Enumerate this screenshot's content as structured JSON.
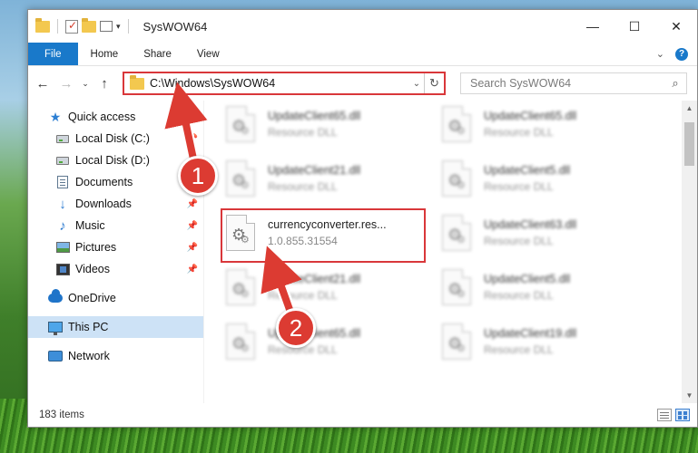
{
  "window": {
    "title": "SysWOW64",
    "controls": {
      "minimize": "—",
      "maximize": "☐",
      "close": "✕"
    }
  },
  "ribbon": {
    "tabs": [
      "File",
      "Home",
      "Share",
      "View"
    ]
  },
  "navbar": {
    "address": "C:\\Windows\\SysWOW64",
    "search_placeholder": "Search SysWOW64"
  },
  "sidebar": {
    "items": [
      {
        "label": "Quick access",
        "icon": "star-icon"
      },
      {
        "label": "Local Disk (C:)",
        "icon": "drive-icon",
        "pinned": true
      },
      {
        "label": "Local Disk (D:)",
        "icon": "drive-icon",
        "pinned": false
      },
      {
        "label": "Documents",
        "icon": "documents-icon",
        "pinned": true
      },
      {
        "label": "Downloads",
        "icon": "download-icon",
        "pinned": true
      },
      {
        "label": "Music",
        "icon": "music-icon",
        "pinned": true
      },
      {
        "label": "Pictures",
        "icon": "pictures-icon",
        "pinned": true
      },
      {
        "label": "Videos",
        "icon": "videos-icon",
        "pinned": true
      },
      {
        "label": "OneDrive",
        "icon": "onedrive-icon"
      },
      {
        "label": "This PC",
        "icon": "this-pc-icon",
        "selected": true
      },
      {
        "label": "Network",
        "icon": "network-icon"
      }
    ]
  },
  "files": [
    {
      "name": "UpdateClient65.dll",
      "sub": "Resource DLL",
      "blurred": true
    },
    {
      "name": "UpdateClient65.dll",
      "sub": "Resource DLL",
      "blurred": true
    },
    {
      "name": "UpdateClient21.dll",
      "sub": "Resource DLL",
      "blurred": true
    },
    {
      "name": "UpdateClient5.dll",
      "sub": "Resource DLL",
      "blurred": true
    },
    {
      "name": "currencyconverter.res...",
      "sub": "1.0.855.31554",
      "blurred": false,
      "highlighted": true
    },
    {
      "name": "UpdateClient63.dll",
      "sub": "Resource DLL",
      "blurred": true
    },
    {
      "name": "UpdateClient21.dll",
      "sub": "Resource DLL",
      "blurred": true
    },
    {
      "name": "UpdateClient5.dll",
      "sub": "Resource DLL",
      "blurred": true
    },
    {
      "name": "UpdateClient65.dll",
      "sub": "Resource DLL",
      "blurred": true
    },
    {
      "name": "UpdateClient19.dll",
      "sub": "Resource DLL",
      "blurred": true
    }
  ],
  "status": {
    "item_count": "183 items"
  },
  "annotations": {
    "badge_1": "1",
    "badge_2": "2",
    "color": "#dc3b32"
  }
}
